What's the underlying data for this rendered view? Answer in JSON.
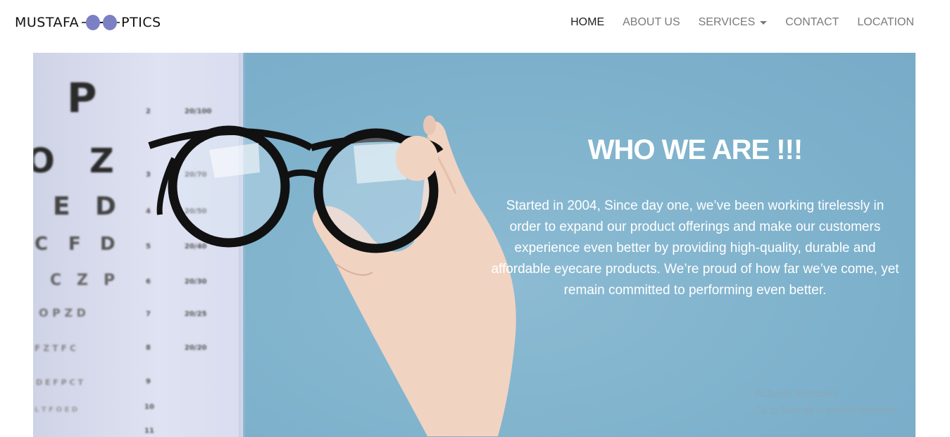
{
  "brand": {
    "name_left": "MUSTAFA",
    "name_right": "PTICS",
    "logo_icon": "glasses-icon",
    "accent_color": "#7b80c4"
  },
  "nav": {
    "items": [
      {
        "label": "HOME",
        "active": true
      },
      {
        "label": "ABOUT US",
        "active": false
      },
      {
        "label": "SERVICES",
        "active": false,
        "dropdown": true
      },
      {
        "label": "CONTACT",
        "active": false
      },
      {
        "label": "LOCATION",
        "active": false
      }
    ]
  },
  "hero": {
    "title": "WHO WE ARE !!!",
    "body": "Started in 2004, Since day one, we’ve been working tirelessly in order to expand our product offerings and make our customers experience even better by providing high-quality, durable and affordable eyecare products. We’re proud of how far we’ve come, yet remain committed to performing even better.",
    "background_color": "#7fb2cc"
  },
  "watermark": {
    "title": "Activate Windows",
    "subtitle": "Go to Settings to activate Windows."
  }
}
